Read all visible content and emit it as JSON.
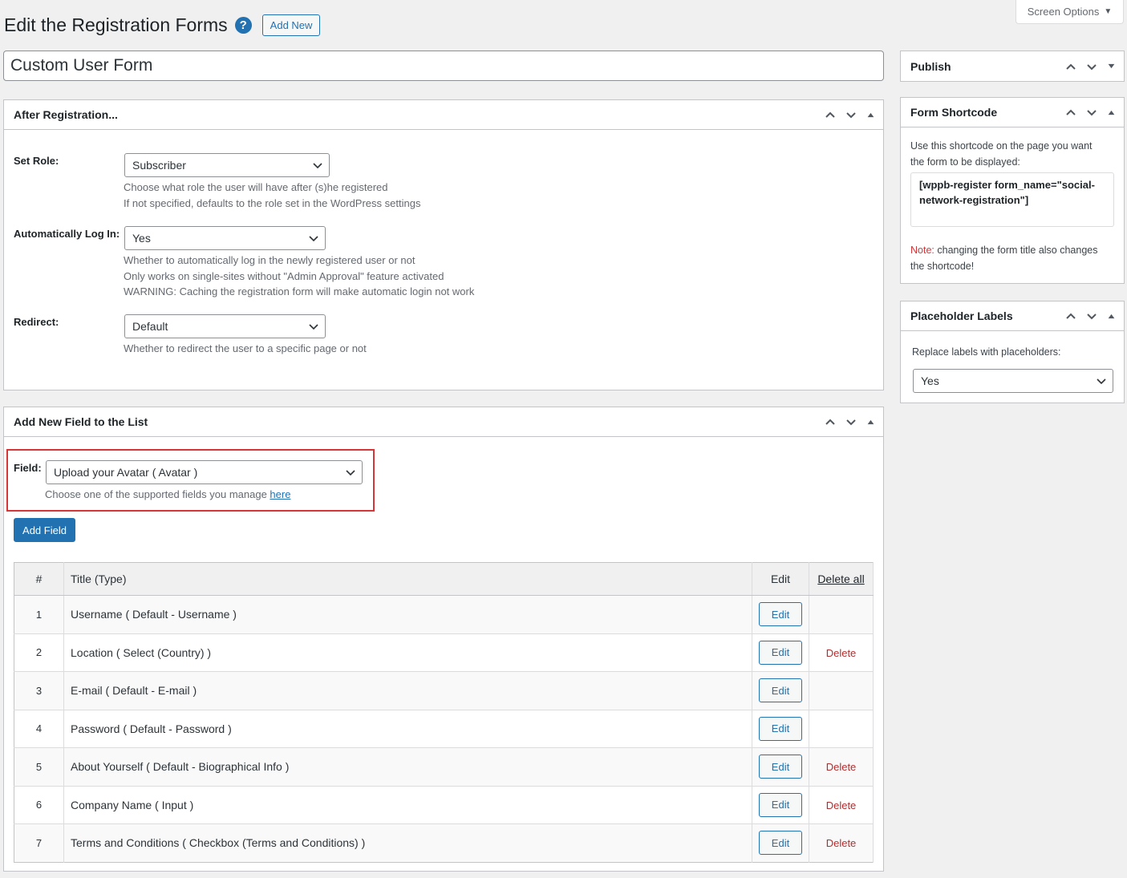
{
  "screen_options": {
    "label": "Screen Options",
    "caret": "▼"
  },
  "header": {
    "title": "Edit the Registration Forms",
    "help_icon": "?",
    "add_new": "Add New"
  },
  "form_title": "Custom User Form",
  "after_registration": {
    "title": "After Registration...",
    "set_role": {
      "label": "Set Role:",
      "value": "Subscriber",
      "desc1": "Choose what role the user will have after (s)he registered",
      "desc2": "If not specified, defaults to the role set in the WordPress settings"
    },
    "auto_login": {
      "label": "Automatically Log In:",
      "value": "Yes",
      "desc1": "Whether to automatically log in the newly registered user or not",
      "desc2": "Only works on single-sites without \"Admin Approval\" feature activated",
      "desc3": "WARNING: Caching the registration form will make automatic login not work"
    },
    "redirect": {
      "label": "Redirect:",
      "value": "Default",
      "desc1": "Whether to redirect the user to a specific page or not"
    }
  },
  "add_field": {
    "title": "Add New Field to the List",
    "field_label": "Field:",
    "field_value": "Upload your Avatar ( Avatar )",
    "help_text": "Choose one of the supported fields you manage ",
    "help_link": "here",
    "button": "Add Field",
    "table": {
      "headers": {
        "num": "#",
        "title": "Title (Type)",
        "edit": "Edit",
        "delete_all": "Delete all"
      },
      "rows": [
        {
          "num": "1",
          "title": "Username ( Default - Username )",
          "edit": "Edit",
          "delete": ""
        },
        {
          "num": "2",
          "title": "Location ( Select (Country) )",
          "edit": "Edit",
          "delete": "Delete"
        },
        {
          "num": "3",
          "title": "E-mail ( Default - E-mail )",
          "edit": "Edit",
          "delete": ""
        },
        {
          "num": "4",
          "title": "Password ( Default - Password )",
          "edit": "Edit",
          "delete": ""
        },
        {
          "num": "5",
          "title": "About Yourself ( Default - Biographical Info )",
          "edit": "Edit",
          "delete": "Delete"
        },
        {
          "num": "6",
          "title": "Company Name ( Input )",
          "edit": "Edit",
          "delete": "Delete"
        },
        {
          "num": "7",
          "title": "Terms and Conditions ( Checkbox (Terms and Conditions) )",
          "edit": "Edit",
          "delete": "Delete"
        }
      ]
    }
  },
  "publish": {
    "title": "Publish"
  },
  "shortcode": {
    "title": "Form Shortcode",
    "intro1": "Use this shortcode on the page you want",
    "intro2": "the form to be displayed:",
    "code1": "[wppb-register form_name=\"social-",
    "code2": "network-registration\"]",
    "note_label": "Note:",
    "note1": " changing the form title also changes",
    "note2": "the shortcode!"
  },
  "placeholder": {
    "title": "Placeholder Labels",
    "label": "Replace labels with placeholders:",
    "value": "Yes"
  },
  "icons": {
    "move_up": "chevron-up-icon",
    "move_down": "chevron-down-icon",
    "toggle": "triangle-toggle-icon",
    "help": "help-icon"
  },
  "colors": {
    "accent": "#2271b1",
    "danger": "#d63638",
    "delete_link": "#b32d2e",
    "highlight_border": "#d63638"
  }
}
